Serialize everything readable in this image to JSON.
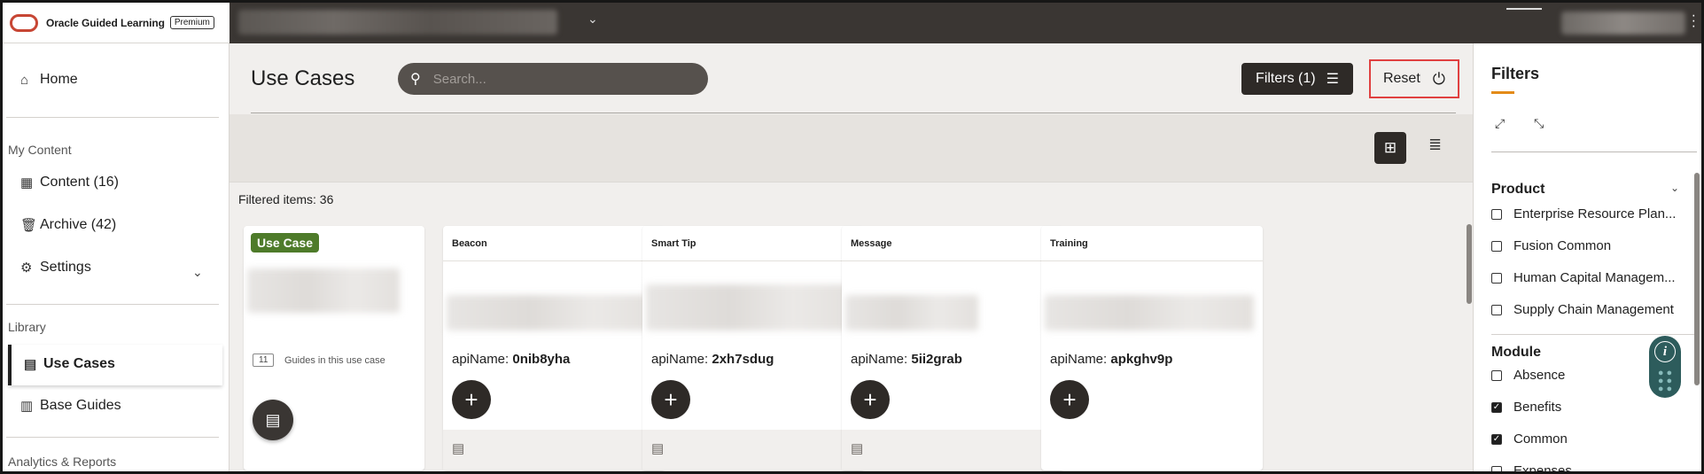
{
  "brand": {
    "name": "Oracle Guided Learning",
    "badge": "Premium"
  },
  "sidebar": {
    "home": "Home",
    "my_content_heading": "My Content",
    "content": "Content (16)",
    "archive": "Archive (42)",
    "settings": "Settings",
    "library_heading": "Library",
    "use_cases": "Use Cases",
    "base_guides": "Base Guides",
    "analytics_heading": "Analytics & Reports"
  },
  "main": {
    "title": "Use Cases",
    "search_placeholder": "Search...",
    "filters_button": "Filters (1)",
    "reset_button": "Reset",
    "filtered_items": "Filtered items: 36"
  },
  "usecase_card": {
    "badge": "Use Case",
    "guide_count": "11",
    "guide_label": "Guides in this use case"
  },
  "cards": [
    {
      "type": "Beacon",
      "api_label": "apiName:",
      "api_value": "0nib8yha"
    },
    {
      "type": "Smart Tip",
      "api_label": "apiName:",
      "api_value": "2xh7sdug"
    },
    {
      "type": "Message",
      "api_label": "apiName:",
      "api_value": "5ii2grab"
    },
    {
      "type": "Training",
      "api_label": "apiName:",
      "api_value": "apkghv9p"
    }
  ],
  "filters_panel": {
    "title": "Filters",
    "product_heading": "Product",
    "product_items": [
      {
        "label": "Enterprise Resource Plan...",
        "checked": false
      },
      {
        "label": "Fusion Common",
        "checked": false
      },
      {
        "label": "Human Capital Managem...",
        "checked": false
      },
      {
        "label": "Supply Chain Management",
        "checked": false
      }
    ],
    "module_heading": "Module",
    "module_items": [
      {
        "label": "Absence",
        "checked": false
      },
      {
        "label": "Benefits",
        "checked": true
      },
      {
        "label": "Common",
        "checked": true
      },
      {
        "label": "Expenses",
        "checked": false
      }
    ]
  },
  "colors": {
    "topbar": "#3a3633",
    "accent_orange": "#e38b18",
    "usecase_green": "#4e7b2a",
    "reset_highlight": "#e04040",
    "help_teal": "#2d5c5c"
  },
  "icons": {
    "home": "home-icon",
    "content": "grid-icon",
    "archive": "trash-icon",
    "settings": "gear-icon",
    "use_cases": "use-cases-icon",
    "base_guides": "building-icon",
    "search": "search-icon",
    "filters": "filter-list-icon",
    "reset": "power-reset-icon",
    "grid_view": "grid-view-icon",
    "list_view": "list-view-icon",
    "add": "plus-icon",
    "guide": "guide-doc-icon",
    "expand": "expand-icon",
    "collapse": "collapse-icon",
    "help": "info-icon"
  }
}
